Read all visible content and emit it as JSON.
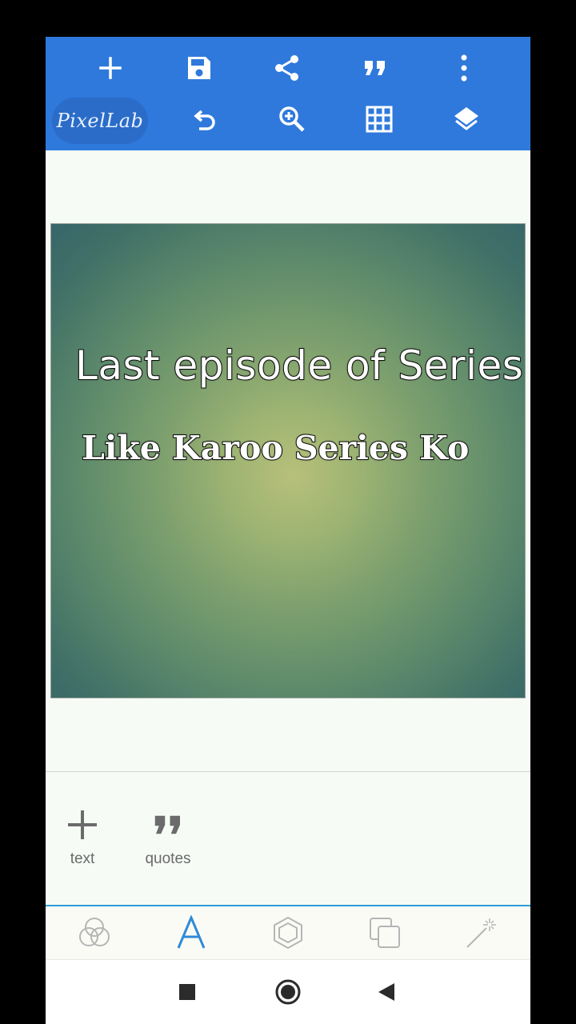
{
  "app": {
    "name": "PixelLab"
  },
  "toolbar": {
    "row1": [
      "add-icon",
      "save-icon",
      "share-icon",
      "quote-icon",
      "more-vert-icon"
    ],
    "row2": [
      "undo-icon",
      "zoom-in-icon",
      "grid-icon",
      "layers-icon"
    ],
    "color": "#2f79dc"
  },
  "canvas": {
    "text_line_1": "Last episode of Series",
    "text_line_2": "Like Karoo Series Ko"
  },
  "tools": [
    {
      "label": "text",
      "icon": "plus-icon"
    },
    {
      "label": "quotes",
      "icon": "quote-icon"
    }
  ],
  "bottom_tabs": [
    {
      "icon": "color-circles-icon",
      "active": false
    },
    {
      "icon": "text-a-icon",
      "active": true
    },
    {
      "icon": "hexagon-shape-icon",
      "active": false
    },
    {
      "icon": "layers-square-icon",
      "active": false
    },
    {
      "icon": "magic-wand-icon",
      "active": false
    }
  ],
  "navbar": [
    "recents-icon",
    "home-icon",
    "back-icon"
  ],
  "colors": {
    "accent": "#2f9bd6",
    "active_tab": "#2f8ad8",
    "inactive_icon": "#b5b5b5"
  }
}
